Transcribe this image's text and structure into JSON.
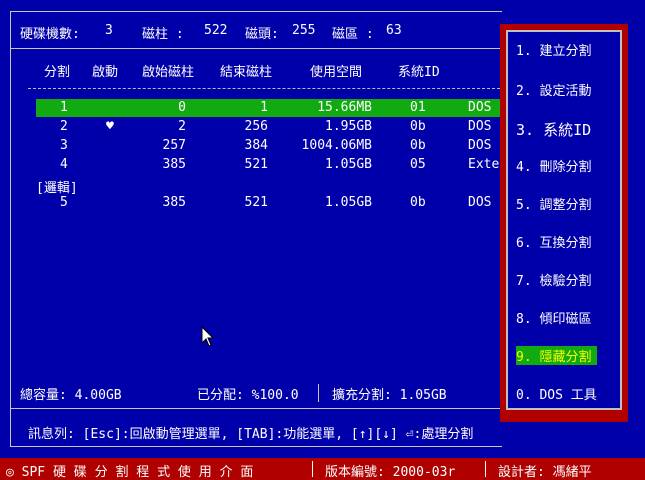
{
  "header": {
    "disk_count_label": "硬碟機數:",
    "disk_count": "3",
    "cylinders_label": "磁柱 :",
    "cylinders": "522",
    "heads_label": "磁頭:",
    "heads": "255",
    "sectors_label": "磁區 :",
    "sectors": "63"
  },
  "table": {
    "columns": [
      "分割",
      "啟動",
      "啟始磁柱",
      "結束磁柱",
      "使用空間",
      "系統ID"
    ],
    "rows": [
      {
        "part": "1",
        "boot": "",
        "start": "0",
        "end": "1",
        "size": "15.66MB",
        "id": "01",
        "type": "DOS"
      },
      {
        "part": "2",
        "boot": "♥",
        "start": "2",
        "end": "256",
        "size": "1.95GB",
        "id": "0b",
        "type": "DOS"
      },
      {
        "part": "3",
        "boot": "",
        "start": "257",
        "end": "384",
        "size": "1004.06MB",
        "id": "0b",
        "type": "DOS"
      },
      {
        "part": "4",
        "boot": "",
        "start": "385",
        "end": "521",
        "size": "1.05GB",
        "id": "05",
        "type": "Exte"
      },
      {
        "part": "5",
        "boot": "",
        "start": "385",
        "end": "521",
        "size": "1.05GB",
        "id": "0b",
        "type": "DOS"
      }
    ],
    "logical_tag": "[邏輯]"
  },
  "summary": {
    "total": "總容量: 4.00GB",
    "allocated": "已分配: %100.0",
    "extended": "擴充分割: 1.05GB"
  },
  "status_bar": "訊息列: [Esc]:回啟動管理選單, [TAB]:功能選單, [↑][↓] ⏎:處理分割",
  "menu": {
    "items": [
      "1. 建立分割",
      "2. 設定活動",
      "3. 系統ID",
      "4. 刪除分割",
      "5. 調整分割",
      "6. 互換分割",
      "7. 檢驗分割",
      "8. 傾印磁區",
      "9. 隱藏分割",
      "0. DOS 工具"
    ],
    "active_index": 8
  },
  "bottom_bar": {
    "title": "◎ SPF 硬 碟 分 割 程 式 使 用 介 面",
    "version": "版本編號: 2000-03r",
    "author": "設計者: 馮緒平"
  },
  "colors": {
    "background": "#0000aa",
    "highlight": "#11aa11",
    "menu_frame": "#b00000"
  }
}
